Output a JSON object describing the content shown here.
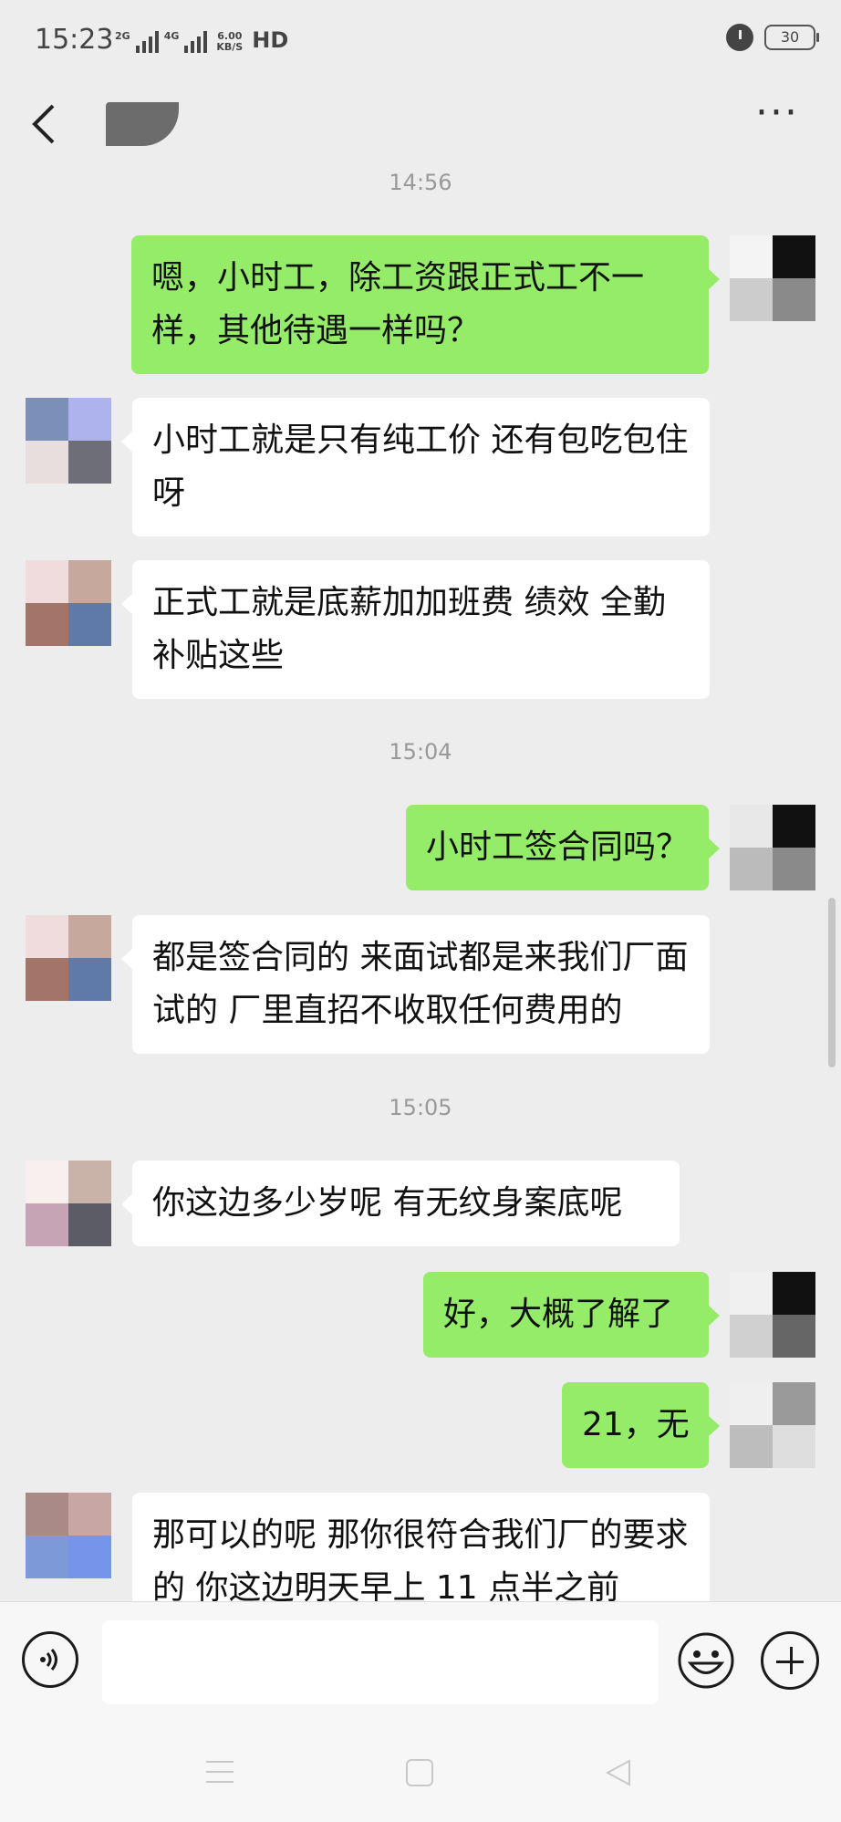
{
  "status_bar": {
    "time": "15:23",
    "signal_1_label": "2G",
    "signal_2_label": "4G",
    "speed_value": "6.00",
    "speed_unit": "KB/S",
    "hd_label": "HD",
    "battery": "30",
    "icons": [
      "signal-icon",
      "alarm-icon",
      "battery-icon"
    ]
  },
  "header": {
    "back_icon": "chevron-left-icon",
    "more_label": "···"
  },
  "timestamps": [
    "14:56",
    "15:04",
    "15:05"
  ],
  "messages": [
    {
      "from": "me",
      "text": "嗯，小时工，除工资跟正式工不一样，其他待遇一样吗？"
    },
    {
      "from": "contact",
      "text": "小时工就是只有纯工价  还有包吃包住呀"
    },
    {
      "from": "contact",
      "text": "正式工就是底薪加加班费  绩效   全勤  补贴这些"
    },
    {
      "from": "me",
      "text": "小时工签合同吗？"
    },
    {
      "from": "contact",
      "text": "都是签合同的  来面试都是来我们厂面试的  厂里直招不收取任何费用的"
    },
    {
      "from": "contact",
      "text": "你这边多少岁呢 有无纹身案底呢"
    },
    {
      "from": "me",
      "text": "好，大概了解了"
    },
    {
      "from": "me",
      "text": "21，无"
    },
    {
      "from": "contact",
      "text": "那可以的呢  那你很符合我们厂的要求的  你这边明天早上 11 点半之前"
    }
  ],
  "input_bar": {
    "voice_icon": "voice-icon",
    "emoji_icon": "emoji-icon",
    "plus_icon": "plus-icon",
    "input_value": ""
  },
  "colors": {
    "background": "#ededed",
    "outgoing_bubble": "#95ec69",
    "incoming_bubble": "#ffffff"
  }
}
